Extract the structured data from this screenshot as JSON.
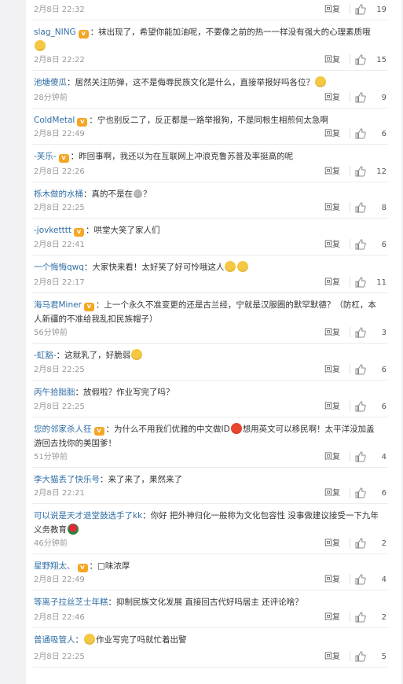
{
  "reply_label": "回复",
  "colors": {
    "username": "#2f6ea5",
    "meta": "#999999",
    "divider": "#ececec"
  },
  "icons": {
    "like": "thumbs-up-icon",
    "vip": "vip-badge-icon"
  },
  "comments": [
    {
      "user": "",
      "vip": false,
      "text": "",
      "time": "2月8日 22:32",
      "likes": "19",
      "height": 26
    },
    {
      "user": "slag_NING",
      "vip": true,
      "text": "：袜出现了，希望你能加油呢，不要像之前的热一一样没有强大的心理素质哦",
      "emoji_end": "yellow",
      "emoji_mid": "",
      "time": "2月8日 22:22",
      "likes": "15",
      "height": 64
    },
    {
      "user": "池塘傻瓜",
      "vip": false,
      "text": "：居然关注防弹，这不是侮辱民族文化是什么，直接举报好吗各位？",
      "emoji_end": "yellow",
      "time": "28分钟前",
      "likes": "9",
      "height": 48
    },
    {
      "user": "ColdMetal",
      "vip": true,
      "text": "：宁也别反二了，反正都是一路举报狗，不是同根生相煎何太急啊",
      "time": "2月8日 22:49",
      "likes": "6",
      "height": 46
    },
    {
      "user": "-芙乐-",
      "vip": true,
      "text": "：昨回事啊，我还以为在互联网上冲浪克鲁苏普及率挺高的呢",
      "time": "2月8日 22:26",
      "likes": "12",
      "height": 48
    },
    {
      "user": "栎木做的水桶",
      "vip": false,
      "text": "：真的不是在",
      "emoji_small": true,
      "text2": "？",
      "time": "2月8日 22:25",
      "likes": "8",
      "height": 46
    },
    {
      "user": "-jovketttt",
      "vip": true,
      "text": "：哄堂大笑了家人们",
      "time": "2月8日 22:41",
      "likes": "6",
      "height": 47
    },
    {
      "user": "一个悔悔qwq",
      "vip": false,
      "text": "：大家快来看！太好笑了好可怜哦这人",
      "emoji_end": "double",
      "time": "2月8日 22:17",
      "likes": "11",
      "height": 48
    },
    {
      "user": "海马君Miner",
      "vip": true,
      "text": "：上一个永久不准变更的还是古兰经，宁就是汉服圈的默罕默德？（防杠，本人新疆的不准给我乱扣民族帽子）",
      "time": "56分钟前",
      "likes": "3",
      "height": 64
    },
    {
      "user": "-虹豁-",
      "vip": false,
      "text": "：这就乳了，好脆弱",
      "emoji_end": "yellow",
      "time": "2月8日 22:25",
      "likes": "6",
      "height": 47
    },
    {
      "user": "丙午拾朏朏",
      "vip": false,
      "text": "：放假啦？作业写完了吗？",
      "time": "2月8日 22:25",
      "likes": "6",
      "height": 47
    },
    {
      "user": "您的邻家杀人狂",
      "vip": true,
      "text": "：为什么不用我们优雅的中文做ID",
      "emoji_mid": "red",
      "text2": "想用英文可以移民啊！太平洋没加盖游回去找你的美国爹！",
      "time": "51分钟前",
      "likes": "4",
      "height": 64
    },
    {
      "user": "李大猫丢了快乐号",
      "vip": false,
      "text": "：来了来了，果然来了",
      "time": "2月8日 22:21",
      "likes": "6",
      "height": 46
    },
    {
      "user": "可以说是天才退堂鼓选手了kk",
      "vip": false,
      "text": "：你好 把外神归化一般称为文化包容性 没事做建议接受一下九年义务教育",
      "emoji_end": "rose",
      "time": "46分钟前",
      "likes": "2",
      "height": 64
    },
    {
      "user": "星野翔太、",
      "vip": true,
      "text": "：□味浓厚",
      "time": "2月8日 22:49",
      "likes": "4",
      "height": 46
    },
    {
      "user": "等离子拉丝芝士年糕",
      "vip": false,
      "text": "：抑制民族文化发展 直接回古代好吗居主 还评论啥？",
      "time": "2月8日 22:46",
      "likes": "2",
      "height": 48
    },
    {
      "user": "普通吸管人",
      "vip": false,
      "text": "：",
      "emoji_mid": "yellow",
      "text2": "作业写完了吗就忙着出警",
      "time": "2月8日 22:25",
      "likes": "5",
      "height": 50
    }
  ]
}
